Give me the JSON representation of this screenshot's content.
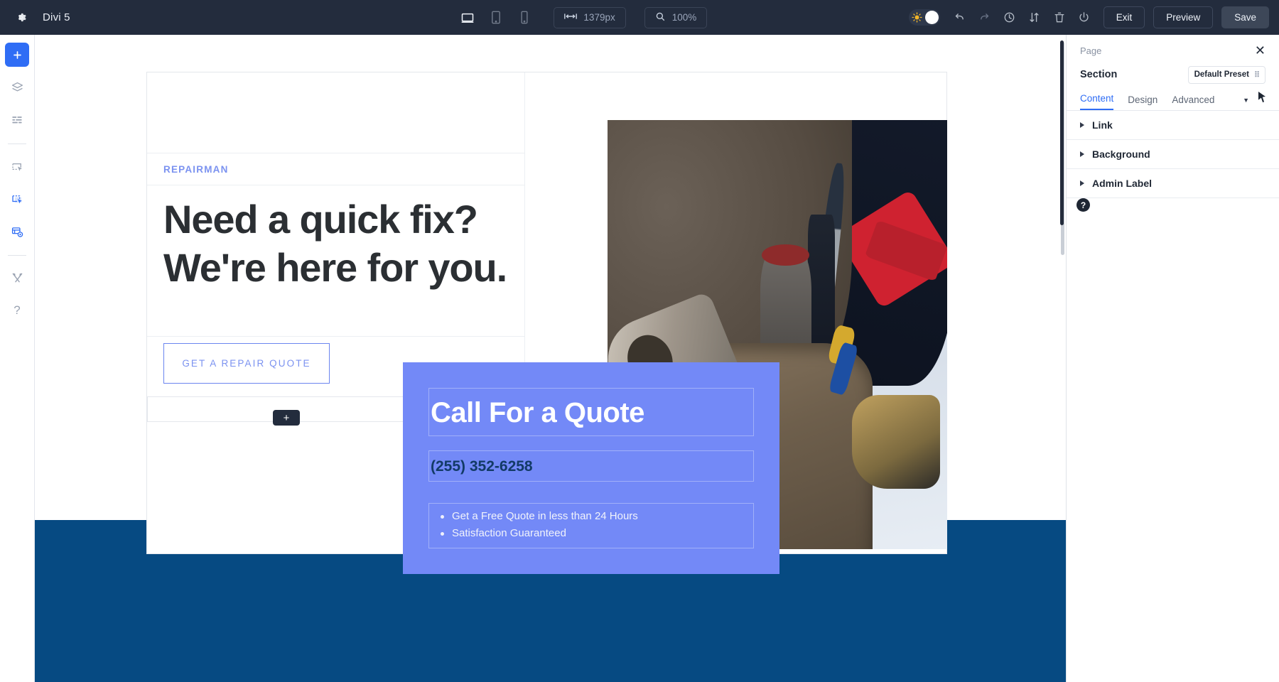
{
  "topbar": {
    "gear_icon": "gear-icon",
    "title": "Divi 5",
    "devices": [
      {
        "name": "desktop",
        "icon": "desktop-icon",
        "active": true
      },
      {
        "name": "tablet",
        "icon": "tablet-icon",
        "active": false
      },
      {
        "name": "phone",
        "icon": "phone-icon",
        "active": false
      }
    ],
    "width_icon": "width-arrows-icon",
    "width_value": "1379px",
    "zoom_icon": "magnifier-icon",
    "zoom_value": "100%",
    "theme_toggle_icon": "sun-icon",
    "icons": [
      {
        "name": "undo-icon"
      },
      {
        "name": "redo-icon"
      },
      {
        "name": "history-clock-icon"
      },
      {
        "name": "sort-updown-icon"
      },
      {
        "name": "trash-icon"
      },
      {
        "name": "power-icon"
      }
    ],
    "exit_label": "Exit",
    "preview_label": "Preview",
    "save_label": "Save"
  },
  "rail": {
    "items": [
      {
        "name": "add-module",
        "icon": "plus-icon"
      },
      {
        "name": "layers",
        "icon": "layers-icon"
      },
      {
        "name": "list-view",
        "icon": "list-icon"
      },
      {
        "name": "select-element",
        "icon": "select-pointer-icon"
      },
      {
        "name": "multi-select",
        "icon": "multi-select-icon"
      },
      {
        "name": "responsive-view",
        "icon": "responsive-preview-icon"
      },
      {
        "name": "tools",
        "icon": "wrench-screwdriver-icon"
      },
      {
        "name": "help",
        "icon": "question-mark-icon"
      }
    ]
  },
  "canvas": {
    "hero": {
      "eyebrow": "REPAIRMAN",
      "headline": "Need a quick fix? We're here for you.",
      "cta_label": "GET A REPAIR QUOTE",
      "add_row_label": "+",
      "image_alt": "tool-belt-photo"
    },
    "overlay": {
      "title": "Call For a Quote",
      "phone": "(255) 352-6258",
      "bullets": [
        "Get a Free Quote in less than 24 Hours",
        "Satisfaction Guaranteed"
      ]
    }
  },
  "panel": {
    "breadcrumb": "Page",
    "close_icon": "close-icon",
    "element_type": "Section",
    "preset_label": "Default Preset",
    "preset_icon": "preset-dots-icon",
    "tabs": [
      {
        "label": "Content",
        "active": true
      },
      {
        "label": "Design",
        "active": false
      },
      {
        "label": "Advanced",
        "active": false
      }
    ],
    "tab_caret_icon": "chevron-down-icon",
    "cursor_icon": "mouse-cursor-icon",
    "accordions": [
      {
        "label": "Link"
      },
      {
        "label": "Background"
      },
      {
        "label": "Admin Label"
      }
    ],
    "help_label": "?"
  },
  "colors": {
    "topbar_bg": "#232c3d",
    "accent_blue": "#2f6df5",
    "overlay_blue": "#7389f7",
    "footer_blue": "#064a82",
    "eyebrow_blue": "#7b92f0",
    "headline_dark": "#2b2f33",
    "phone_navy": "#123a66"
  }
}
